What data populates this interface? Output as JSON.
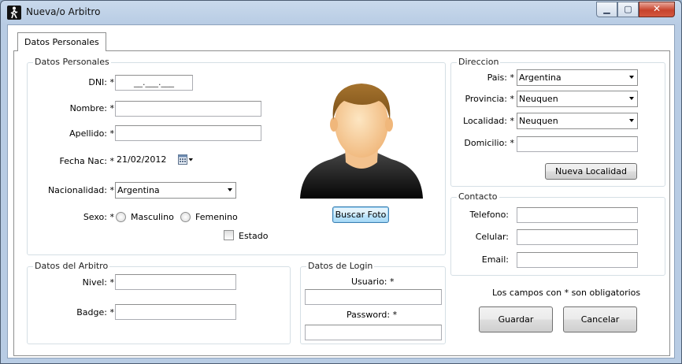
{
  "window": {
    "title": "Nueva/o Arbitro",
    "controls": {
      "minimize": "▁",
      "maximize": "▢",
      "close": "✕"
    }
  },
  "tabs": [
    {
      "label": "Datos Personales",
      "selected": true
    }
  ],
  "personal": {
    "legend": "Datos Personales",
    "dni_label": "DNI: *",
    "dni_value": "__.___.___",
    "nombre_label": "Nombre: *",
    "nombre_value": "",
    "apellido_label": "Apellido: *",
    "apellido_value": "",
    "fecha_label": "Fecha Nac: *",
    "fecha_value": "21/02/2012",
    "nacionalidad_label": "Nacionalidad: *",
    "nacionalidad_value": "Argentina",
    "sexo_label": "Sexo: *",
    "sexo_options": [
      "Masculino",
      "Femenino"
    ],
    "estado_label": "Estado",
    "buscar_foto": "Buscar Foto"
  },
  "arbitro": {
    "legend": "Datos del Arbitro",
    "nivel_label": "Nivel: *",
    "nivel_value": "",
    "badge_label": "Badge: *",
    "badge_value": ""
  },
  "login": {
    "legend": "Datos de Login",
    "usuario_label": "Usuario: *",
    "usuario_value": "",
    "password_label": "Password: *",
    "password_value": ""
  },
  "direccion": {
    "legend": "Direccion",
    "pais_label": "Pais: *",
    "pais_value": "Argentina",
    "provincia_label": "Provincia: *",
    "provincia_value": "Neuquen",
    "localidad_label": "Localidad: *",
    "localidad_value": "Neuquen",
    "domicilio_label": "Domicilio: *",
    "domicilio_value": "",
    "nueva_localidad": "Nueva Localidad"
  },
  "contacto": {
    "legend": "Contacto",
    "telefono_label": "Telefono:",
    "telefono_value": "",
    "celular_label": "Celular:",
    "celular_value": "",
    "email_label": "Email:",
    "email_value": ""
  },
  "footer": {
    "note": "Los campos con * son obligatorios",
    "guardar": "Guardar",
    "cancelar": "Cancelar"
  },
  "colors": {
    "accent": "#3c7fb1",
    "close_red": "#c7432c"
  },
  "icons": {
    "app": "referee-icon",
    "calendar": "calendar-icon",
    "photo": "person-placeholder"
  }
}
